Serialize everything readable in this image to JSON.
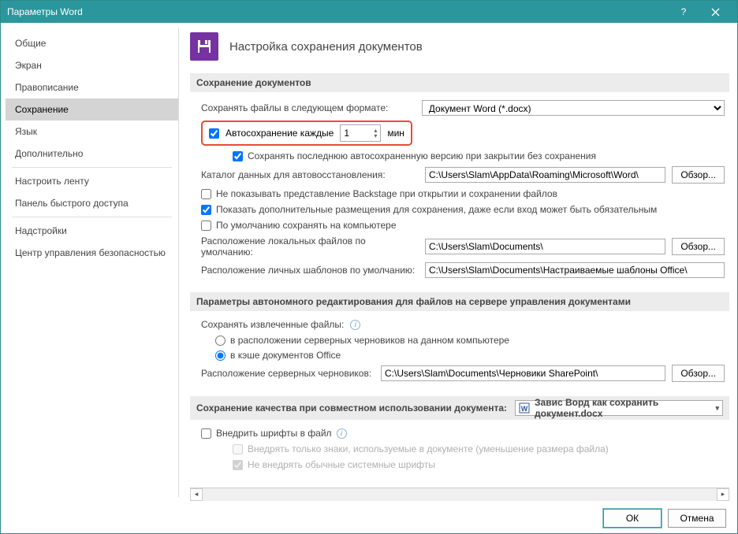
{
  "window": {
    "title": "Параметры Word"
  },
  "sidebar": {
    "items": [
      "Общие",
      "Экран",
      "Правописание",
      "Сохранение",
      "Язык",
      "Дополнительно",
      "Настроить ленту",
      "Панель быстрого доступа",
      "Надстройки",
      "Центр управления безопасностью"
    ],
    "selected_index": 3
  },
  "heading": {
    "title": "Настройка сохранения документов"
  },
  "section_save": {
    "title": "Сохранение документов",
    "save_format_label": "Сохранять файлы в следующем формате:",
    "save_format_value": "Документ Word (*.docx)",
    "autosave_label": "Автосохранение каждые",
    "autosave_value": "1",
    "autosave_unit": "мин",
    "keep_last_label": "Сохранять последнюю автосохраненную версию при закрытии без сохранения",
    "autorecover_label": "Каталог данных для автовосстановления:",
    "autorecover_path": "C:\\Users\\Slam\\AppData\\Roaming\\Microsoft\\Word\\",
    "no_backstage_label": "Не показывать представление Backstage при открытии и сохранении файлов",
    "show_additional_label": "Показать дополнительные размещения для сохранения, даже если вход может быть обязательным",
    "save_to_computer_label": "По умолчанию сохранять на компьютере",
    "default_local_label": "Расположение локальных файлов по умолчанию:",
    "default_local_path": "C:\\Users\\Slam\\Documents\\",
    "default_templates_label": "Расположение личных шаблонов по умолчанию:",
    "default_templates_path": "C:\\Users\\Slam\\Documents\\Настраиваемые шаблоны Office\\",
    "browse_label": "Обзор..."
  },
  "section_offline": {
    "title": "Параметры автономного редактирования для файлов на сервере управления документами",
    "save_checked_out_label": "Сохранять извлеченные файлы:",
    "radio_server_drafts": "в расположении серверных черновиков на данном компьютере",
    "radio_office_cache": "в кэше документов Office",
    "server_drafts_label": "Расположение серверных черновиков:",
    "server_drafts_path": "C:\\Users\\Slam\\Documents\\Черновики SharePoint\\",
    "browse_label": "Обзор..."
  },
  "section_sharing": {
    "title": "Сохранение качества при совместном использовании документа:",
    "doc_name": "Завис Ворд как сохранить документ.docx",
    "embed_fonts_label": "Внедрить шрифты в файл",
    "embed_chars_label": "Внедрять только знаки, используемые в документе (уменьшение размера файла)",
    "no_system_fonts_label": "Не внедрять обычные системные шрифты"
  },
  "footer": {
    "ok": "ОК",
    "cancel": "Отмена"
  }
}
